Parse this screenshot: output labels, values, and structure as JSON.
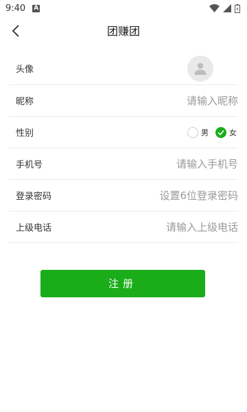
{
  "status_bar": {
    "time": "9:40",
    "notification_icon": "a-icon"
  },
  "header": {
    "title": "团赚团",
    "back_icon": "chevron-left-icon"
  },
  "form": {
    "avatar": {
      "label": "头像",
      "icon": "user-avatar-icon"
    },
    "nickname": {
      "label": "昵称",
      "placeholder": "请输入昵称"
    },
    "gender": {
      "label": "性别",
      "options": [
        "男",
        "女"
      ],
      "selected": "女"
    },
    "phone": {
      "label": "手机号",
      "placeholder": "请输入手机号"
    },
    "password": {
      "label": "登录密码",
      "placeholder": "设置6位登录密码"
    },
    "superior_phone": {
      "label": "上级电话",
      "placeholder": "请输入上级电话"
    }
  },
  "register_button": {
    "label": "注册"
  },
  "colors": {
    "accent": "#1aad19",
    "divider": "#ececec",
    "placeholder": "#999999"
  }
}
